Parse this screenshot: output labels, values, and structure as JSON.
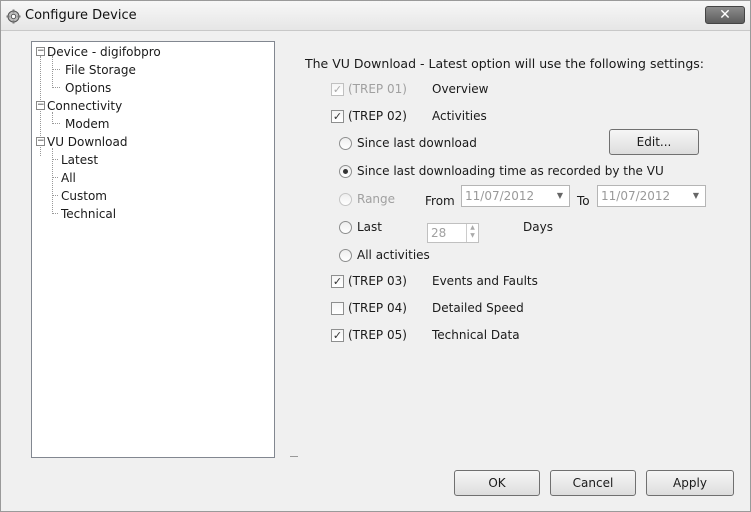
{
  "window": {
    "title": "Configure Device",
    "close_label": "✕",
    "icon": "device-settings-icon"
  },
  "tree": {
    "device": {
      "label": "Device - digifobpro",
      "children": [
        "File Storage",
        "Options"
      ]
    },
    "connectivity": {
      "label": "Connectivity",
      "children": [
        "Modem"
      ]
    },
    "vu_download": {
      "label": "VU Download",
      "children": [
        "Latest",
        "All",
        "Custom",
        "Technical"
      ]
    },
    "selected": "Latest"
  },
  "main": {
    "heading": "The VU Download - Latest option will use the following settings:",
    "trep01": {
      "code": "(TREP 01)",
      "name": "Overview",
      "checked": true,
      "disabled": true
    },
    "trep02": {
      "code": "(TREP 02)",
      "name": "Activities",
      "checked": true
    },
    "options": {
      "since_last_download": "Since last download",
      "edit_button": "Edit...",
      "since_last_recorded": "Since last downloading time as recorded by the VU",
      "range": "Range",
      "from": "From",
      "from_date": "11/07/2012",
      "to": "To",
      "to_date": "11/07/2012",
      "last": "Last",
      "last_value": "28",
      "days": "Days",
      "all_activities": "All activities",
      "selected": "Since last downloading time as recorded by the VU"
    },
    "trep03": {
      "code": "(TREP 03)",
      "name": "Events and Faults",
      "checked": true
    },
    "trep04": {
      "code": "(TREP 04)",
      "name": "Detailed Speed",
      "checked": false
    },
    "trep05": {
      "code": "(TREP 05)",
      "name": "Technical Data",
      "checked": true
    }
  },
  "footer": {
    "ok": "OK",
    "cancel": "Cancel",
    "apply": "Apply"
  },
  "colors": {
    "window_bg": "#f0f0f0",
    "close_button": "#6e6e6e",
    "disabled_text": "#a0a0a0"
  }
}
